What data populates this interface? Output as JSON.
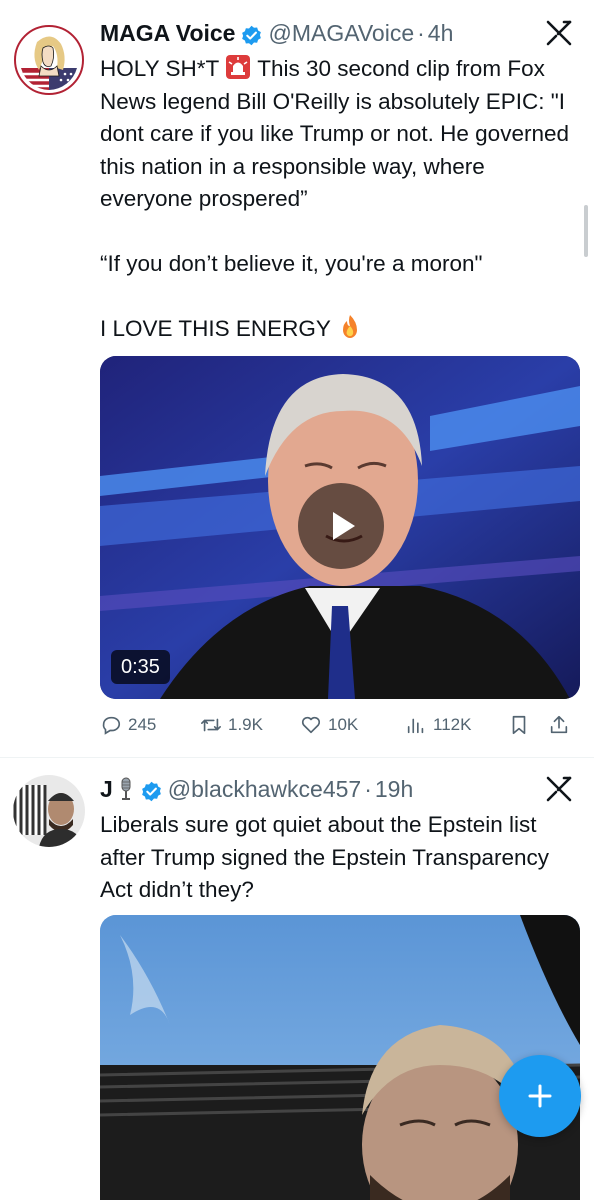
{
  "tweets": [
    {
      "author": {
        "name": "MAGA Voice",
        "handle": "@MAGAVoice",
        "time": "4h",
        "verified": true
      },
      "text_line1_a": "HOLY SH*T",
      "text_line1_b": "This 30 second clip from",
      "text_rest": "Fox News legend Bill O'Reilly is absolutely EPIC: \"I dont care if you like Trump or not. He governed this nation in a responsible way, where everyone prospered”",
      "quote": "“If you don’t believe it, you're a moron\"",
      "closing": "I LOVE THIS ENERGY",
      "video": {
        "duration": "0:35"
      },
      "stats": {
        "replies": "245",
        "reposts": "1.9K",
        "likes": "10K",
        "views": "112K"
      },
      "icons": [
        "siren-emoji",
        "fire-emoji",
        "play-icon",
        "reply-icon",
        "repost-icon",
        "like-icon",
        "views-icon",
        "bookmark-icon",
        "share-icon",
        "grok-icon",
        "verified-icon"
      ]
    },
    {
      "author": {
        "name": "J",
        "handle": "@blackhawkce457",
        "time": "19h",
        "verified": true
      },
      "text": "Liberals sure got quiet about the Epstein list after Trump signed the Epstein Transparency Act didn’t they?",
      "icons": [
        "microphone-emoji",
        "verified-icon",
        "grok-icon",
        "compose-icon"
      ]
    }
  ],
  "colors": {
    "accent": "#1d9bf0",
    "text": "#0f1419",
    "secondary": "#536471"
  }
}
